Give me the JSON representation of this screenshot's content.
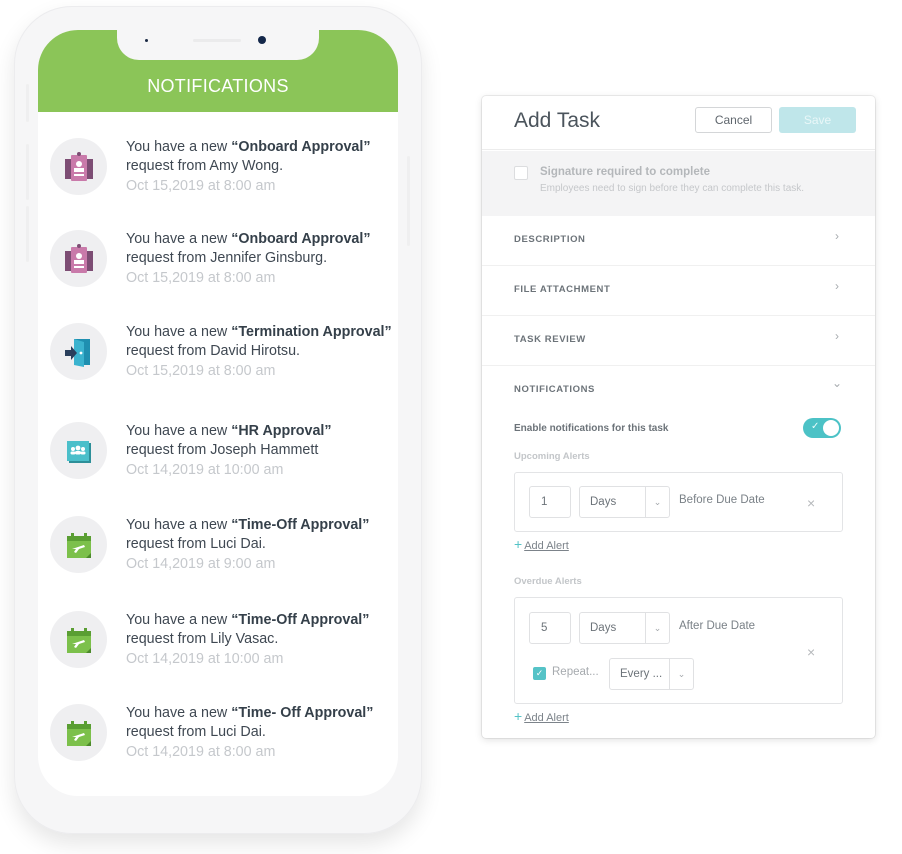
{
  "phone": {
    "header_title": "NOTIFICATIONS",
    "header_color": "#8bc558",
    "notifications": [
      {
        "prefix": "You have a new ",
        "type": "“Onboard Approval”",
        "line2": "request from Amy Wong.",
        "time": "Oct 15,2019 at 8:00 am",
        "icon": "onboard-badge-icon"
      },
      {
        "prefix": "You have a new ",
        "type": "“Onboard Approval”",
        "line2": "request from Jennifer Ginsburg.",
        "time": "Oct 15,2019 at 8:00 am",
        "icon": "onboard-badge-icon"
      },
      {
        "prefix": "You have a new ",
        "type": "“Termination Approval”",
        "line2": "request from David Hirotsu.",
        "time": "Oct 15,2019 at 8:00 am",
        "icon": "exit-door-icon"
      },
      {
        "prefix": "You have a new ",
        "type": "“HR Approval”",
        "line2": "request  from Joseph Hammett",
        "time": "Oct 14,2019 at 10:00 am",
        "icon": "hr-team-icon"
      },
      {
        "prefix": "You have a new ",
        "type": "“Time-Off Approval”",
        "line2": "request from Luci Dai.",
        "time": "Oct 14,2019 at 9:00 am",
        "icon": "calendar-flight-icon"
      },
      {
        "prefix": "You have a new ",
        "type": "“Time-Off Approval”",
        "line2": "request from Lily Vasac.",
        "time": "Oct 14,2019 at 10:00 am",
        "icon": "calendar-flight-icon"
      },
      {
        "prefix": "You have a new ",
        "type": "“Time- Off Approval”",
        "line2": "request from Luci Dai.",
        "time": "Oct 14,2019 at 8:00 am",
        "icon": "calendar-flight-icon"
      }
    ]
  },
  "panel": {
    "title": "Add Task",
    "cancel_label": "Cancel",
    "save_label": "Save",
    "signature": {
      "title": "Signature required to complete",
      "subtitle": "Employees need to sign before they can complete this task.",
      "checked": false
    },
    "sections": [
      {
        "label": "DESCRIPTION",
        "chevron": "›"
      },
      {
        "label": "FILE ATTACHMENT",
        "chevron": "›"
      },
      {
        "label": "TASK REVIEW",
        "chevron": "›"
      },
      {
        "label": "NOTIFICATIONS",
        "chevron": "⌄"
      }
    ],
    "notifications": {
      "enable_label": "Enable notifications for this task",
      "enabled": true,
      "toggle_check": "✓",
      "upcoming_label": "Upcoming Alerts",
      "upcoming": {
        "amount": "1",
        "unit": "Days",
        "relation": "Before Due Date",
        "remove": "×"
      },
      "overdue_label": "Overdue Alerts",
      "overdue": {
        "amount": "5",
        "unit": "Days",
        "relation": "After Due Date",
        "remove": "×",
        "repeat_checked": true,
        "repeat_label": "Repeat...",
        "repeat_check": "✓",
        "frequency": "Every ..."
      },
      "add_alert_label": "Add Alert",
      "add_alert_plus": "+",
      "select_arrow": "⌄"
    },
    "accent_color": "#4cc2c6"
  }
}
